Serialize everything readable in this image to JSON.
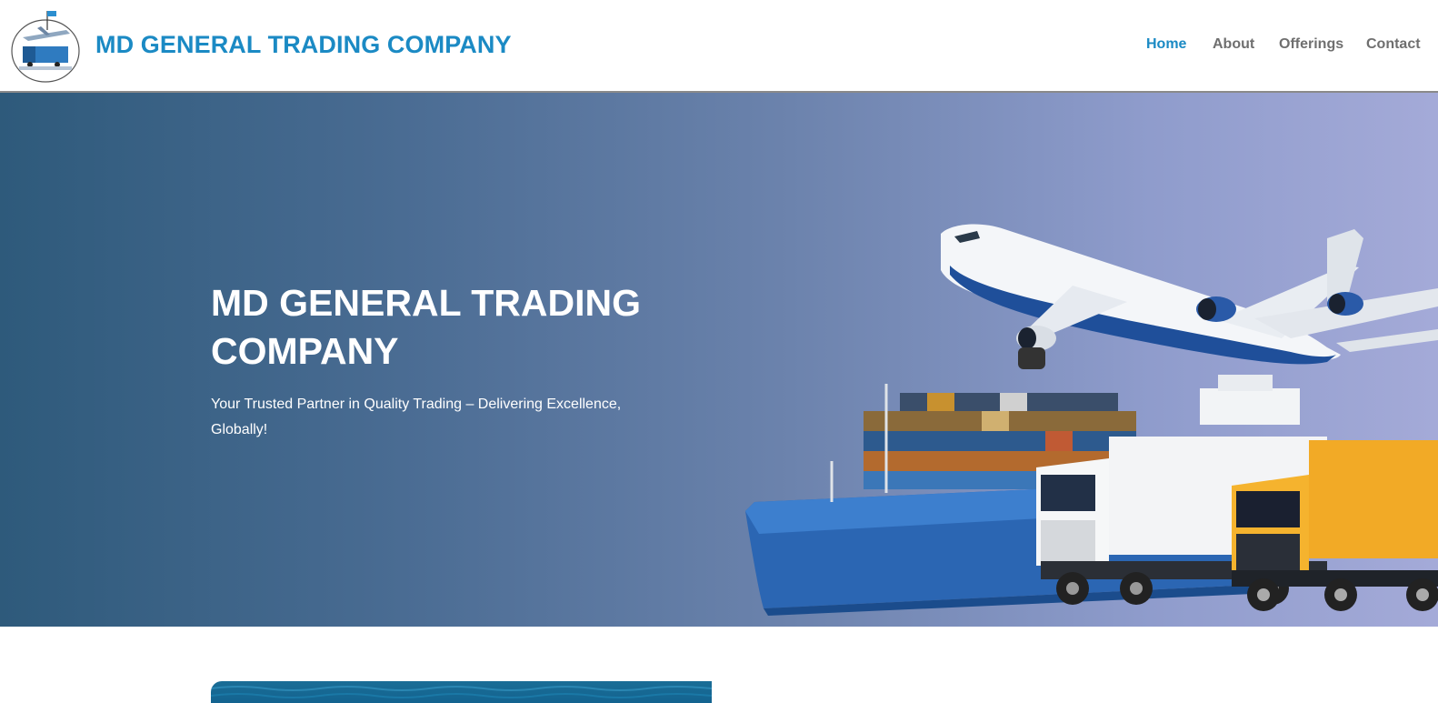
{
  "header": {
    "site_title": "MD GENERAL TRADING COMPANY",
    "logo_icon": "logo-globe-plane-truck-icon",
    "nav": [
      {
        "label": "Home",
        "active": true
      },
      {
        "label": "About",
        "active": false
      },
      {
        "label": "Offerings",
        "active": false
      },
      {
        "label": "Contact",
        "active": false
      }
    ]
  },
  "hero": {
    "title": "MD GENERAL TRADING COMPANY",
    "subtitle": "Your Trusted Partner in Quality Trading – Delivering Excellence, Globally!",
    "image_icon": "logistics-plane-ship-trucks-icon"
  },
  "colors": {
    "brand": "#1b8ac4",
    "nav_inactive": "#6f6f6f",
    "hero_gradient_start": "#2e5a7b",
    "hero_gradient_end": "#a4aad8"
  }
}
